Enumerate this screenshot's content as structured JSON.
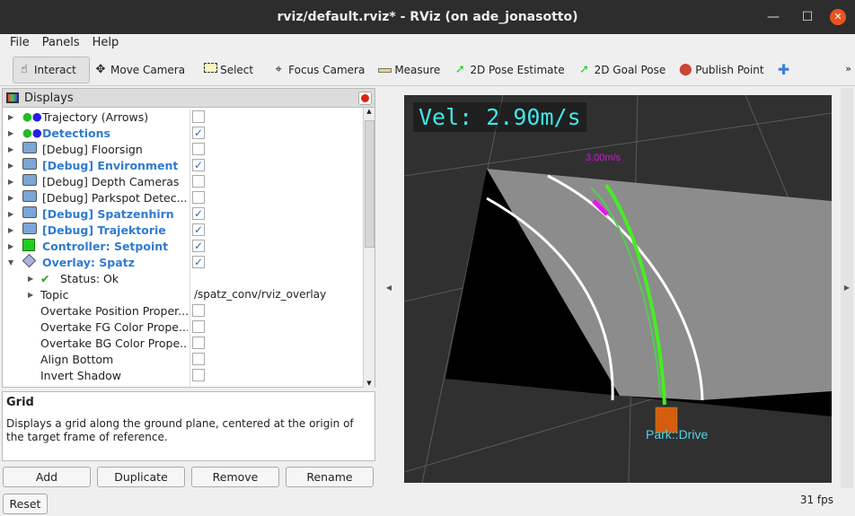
{
  "window": {
    "title": "rviz/default.rviz* - RViz (on ade_jonasotto)"
  },
  "menu": [
    "File",
    "Panels",
    "Help"
  ],
  "toolbar": [
    {
      "label": "Interact",
      "icon": "hand-icon",
      "active": true
    },
    {
      "label": "Move Camera",
      "icon": "move-camera-icon"
    },
    {
      "label": "Select",
      "icon": "select-icon"
    },
    {
      "label": "Focus Camera",
      "icon": "focus-camera-icon"
    },
    {
      "label": "Measure",
      "icon": "ruler-icon"
    },
    {
      "label": "2D Pose Estimate",
      "icon": "green-arrow-icon"
    },
    {
      "label": "2D Goal Pose",
      "icon": "green-arrow-icon"
    },
    {
      "label": "Publish Point",
      "icon": "map-pin-icon"
    },
    {
      "label": "",
      "icon": "plus-icon"
    }
  ],
  "displays": {
    "title": "Displays",
    "rows": [
      {
        "label": "Trajectory (Arrows)",
        "icon": "markers",
        "checked": false,
        "bold": false
      },
      {
        "label": "Detections",
        "icon": "markers",
        "checked": true,
        "bold": true
      },
      {
        "label": "[Debug] Floorsign",
        "icon": "folder",
        "checked": false,
        "bold": false
      },
      {
        "label": "[Debug] Environment",
        "icon": "folder",
        "checked": true,
        "bold": true
      },
      {
        "label": "[Debug] Depth Cameras",
        "icon": "folder",
        "checked": false,
        "bold": false
      },
      {
        "label": "[Debug] Parkspot Detec...",
        "icon": "folder",
        "checked": false,
        "bold": false
      },
      {
        "label": "[Debug] Spatzenhirn",
        "icon": "folder",
        "checked": true,
        "bold": true
      },
      {
        "label": "[Debug] Trajektorie",
        "icon": "folder",
        "checked": true,
        "bold": true
      },
      {
        "label": "Controller: Setpoint",
        "icon": "cube",
        "checked": true,
        "bold": true
      },
      {
        "label": "Overlay: Spatz",
        "icon": "diamond",
        "checked": true,
        "bold": true,
        "expanded": true
      }
    ],
    "props": [
      {
        "label": "Status: Ok",
        "status": true,
        "expandable": true
      },
      {
        "label": "Topic",
        "value": "/spatz_conv/rviz_overlay",
        "expandable": true
      },
      {
        "label": "Overtake Position Proper...",
        "checked": false
      },
      {
        "label": "Overtake FG Color Prope...",
        "checked": false
      },
      {
        "label": "Overtake BG Color Prope...",
        "checked": false
      },
      {
        "label": "Align Bottom",
        "checked": false
      },
      {
        "label": "Invert Shadow",
        "checked": false
      }
    ]
  },
  "description": {
    "title": "Grid",
    "text": "Displays a grid along the ground plane, centered at the origin of the target frame of reference."
  },
  "buttons": {
    "add": "Add",
    "duplicate": "Duplicate",
    "remove": "Remove",
    "rename": "Rename",
    "reset": "Reset"
  },
  "viewport": {
    "velocity": "Vel: 2.90m/s",
    "target_speed": "3.00m/s",
    "state": "Park::Drive"
  },
  "status": {
    "fps": "31 fps"
  }
}
